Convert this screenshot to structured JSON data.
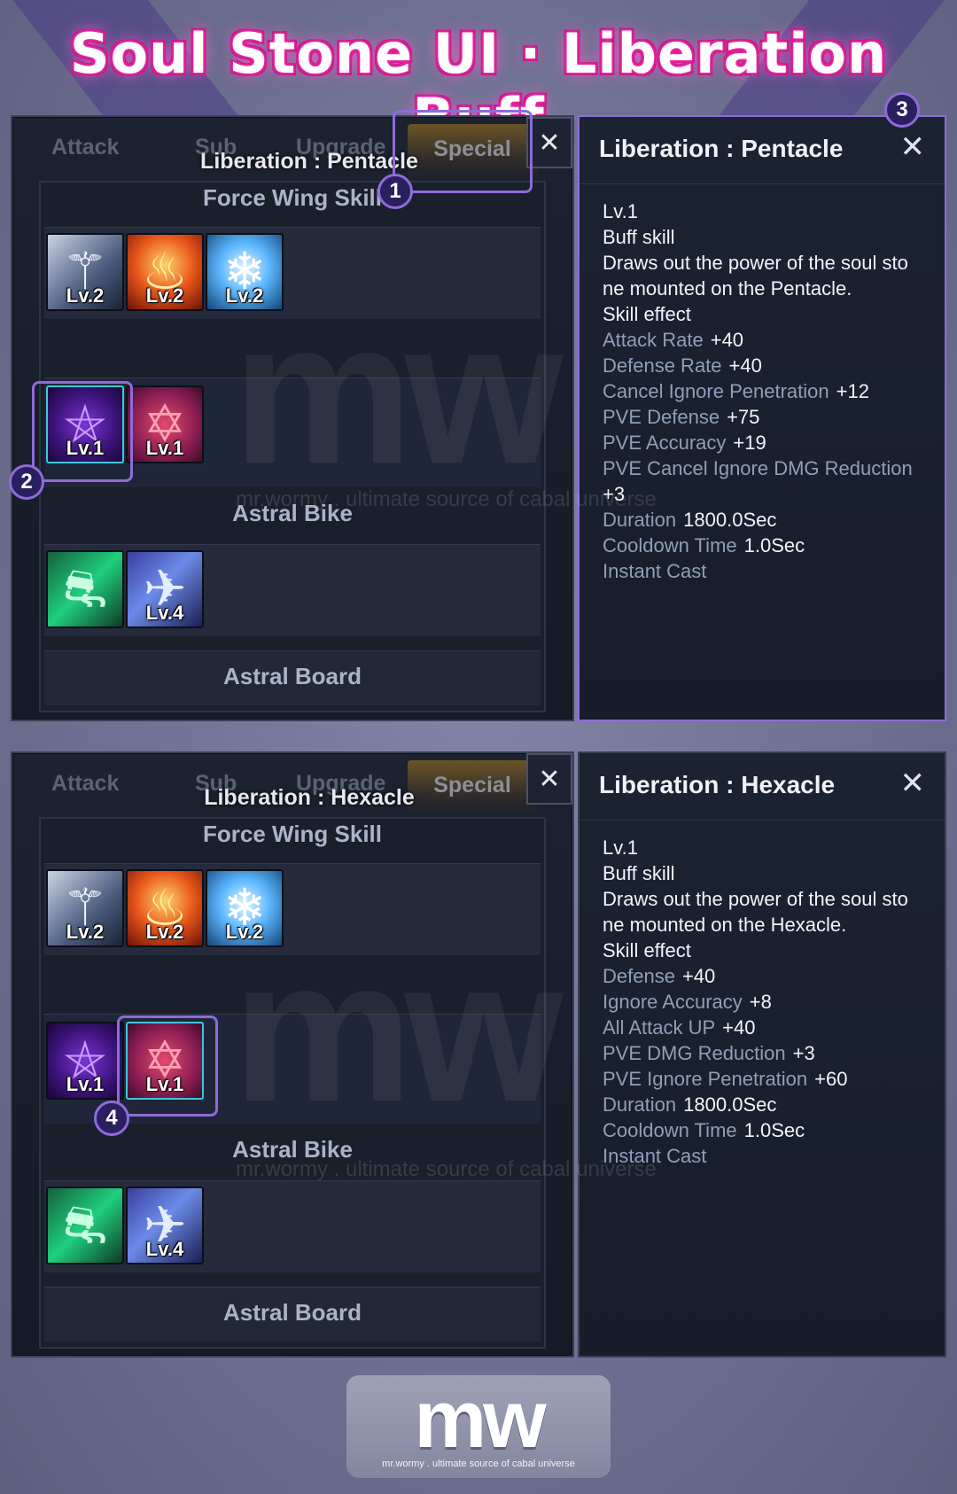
{
  "page_title": "Soul Stone UI · Liberation Buff",
  "tabs": [
    "Attack",
    "Sub",
    "Upgrade",
    "Special"
  ],
  "close_glyph": "✕",
  "windows": [
    {
      "caption": "Liberation : Pentacle",
      "sections": [
        "Force Wing Skill",
        "Astral Bike",
        "Astral Board"
      ],
      "wing_icons": [
        {
          "icon": "wing-dark-icon",
          "level": "Lv.2"
        },
        {
          "icon": "wing-fire-icon",
          "level": "Lv.2"
        },
        {
          "icon": "wing-ice-icon",
          "level": "Lv.2"
        }
      ],
      "liberation_icons": [
        {
          "icon": "pentacle-icon",
          "level": "Lv.1"
        },
        {
          "icon": "hexacle-icon",
          "level": "Lv.1"
        }
      ],
      "board_icons": [
        {
          "icon": "astral-bike-icon",
          "level": ""
        },
        {
          "icon": "astral-board-icon",
          "level": "Lv.4"
        }
      ]
    },
    {
      "caption": "Liberation : Hexacle",
      "sections": [
        "Force Wing Skill",
        "Astral Bike",
        "Astral Board"
      ],
      "wing_icons": [
        {
          "icon": "wing-dark-icon",
          "level": "Lv.2"
        },
        {
          "icon": "wing-fire-icon",
          "level": "Lv.2"
        },
        {
          "icon": "wing-ice-icon",
          "level": "Lv.2"
        }
      ],
      "liberation_icons": [
        {
          "icon": "pentacle-icon",
          "level": "Lv.1"
        },
        {
          "icon": "hexacle-icon",
          "level": "Lv.1"
        }
      ],
      "board_icons": [
        {
          "icon": "astral-bike-icon",
          "level": ""
        },
        {
          "icon": "astral-board-icon",
          "level": "Lv.4"
        }
      ]
    }
  ],
  "tooltips": [
    {
      "title": "Liberation : Pentacle",
      "level": "Lv.1",
      "type": "Buff skill",
      "desc1": "Draws out the power of the soul sto",
      "desc2": "ne mounted on the Pentacle.",
      "effect_label": "Skill effect",
      "stats": [
        {
          "name": "Attack Rate",
          "value": "+40"
        },
        {
          "name": "Defense Rate",
          "value": "+40"
        },
        {
          "name": "Cancel Ignore Penetration",
          "value": "+12"
        },
        {
          "name": "PVE Defense",
          "value": "+75"
        },
        {
          "name": "PVE Accuracy",
          "value": "+19"
        },
        {
          "name": "PVE Cancel Ignore DMG Reduction",
          "value": "+3"
        },
        {
          "name": "Duration",
          "value": "1800.0Sec"
        },
        {
          "name": "Cooldown Time",
          "value": "1.0Sec"
        }
      ],
      "footer": "Instant Cast"
    },
    {
      "title": "Liberation : Hexacle",
      "level": "Lv.1",
      "type": "Buff skill",
      "desc1": "Draws out the power of the soul sto",
      "desc2": "ne mounted on the Hexacle.",
      "effect_label": "Skill effect",
      "stats": [
        {
          "name": "Defense",
          "value": "+40"
        },
        {
          "name": "Ignore Accuracy",
          "value": "+8"
        },
        {
          "name": "All Attack UP",
          "value": "+40"
        },
        {
          "name": "PVE DMG Reduction",
          "value": "+3"
        },
        {
          "name": "PVE Ignore Penetration",
          "value": "+60"
        },
        {
          "name": "Duration",
          "value": "1800.0Sec"
        },
        {
          "name": "Cooldown Time",
          "value": "1.0Sec"
        }
      ],
      "footer": "Instant Cast"
    }
  ],
  "markers": [
    "1",
    "2",
    "3",
    "4"
  ],
  "watermark": {
    "mark": "mw",
    "tagline": "mr.wormy . ultimate source of cabal universe"
  },
  "colors": {
    "title_glow": "#ff2fb0",
    "highlight": "#8e6bd8",
    "stat_name": "#8f9fb8"
  }
}
